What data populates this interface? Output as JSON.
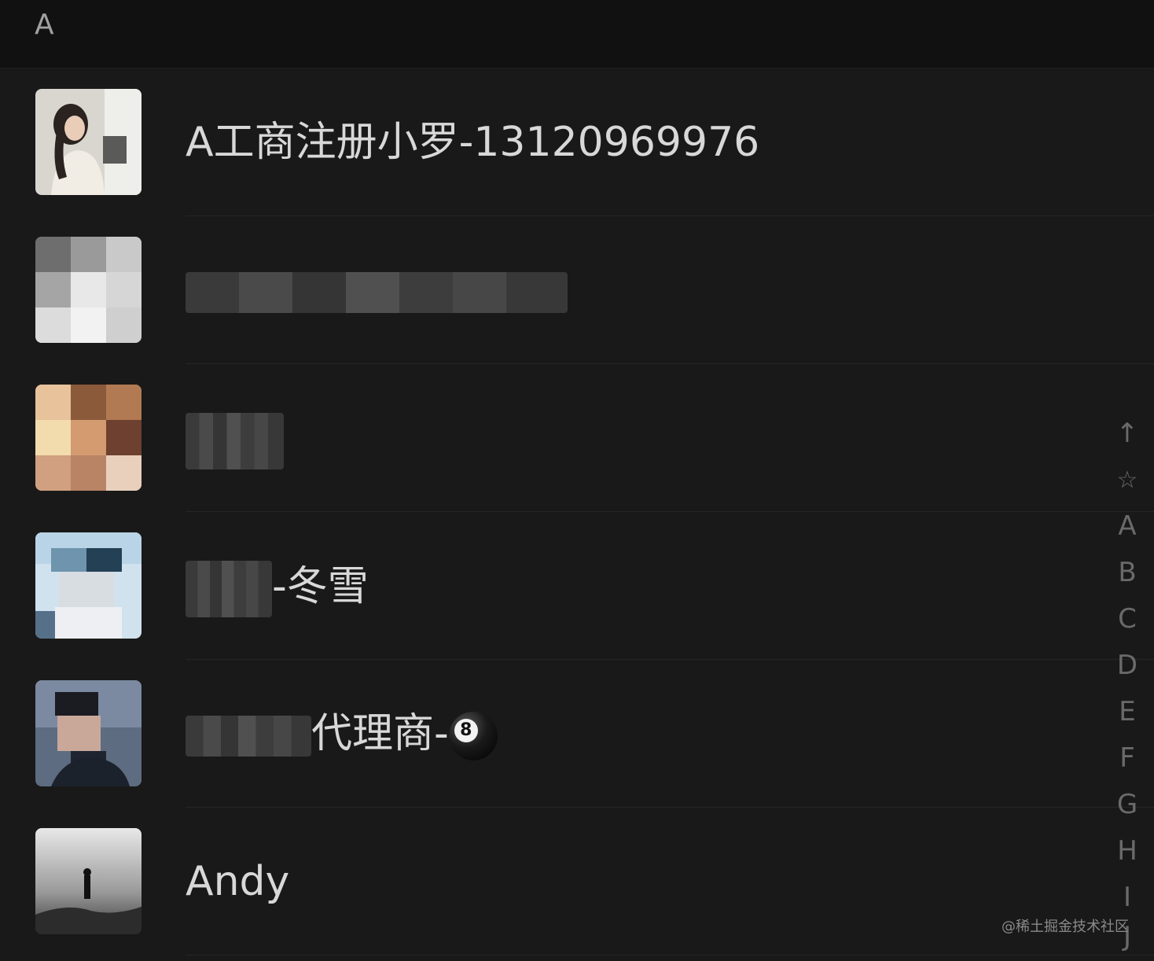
{
  "section": {
    "letter": "A"
  },
  "contacts": [
    {
      "name": "A工商注册小罗-13120969976",
      "avatar": "photo-woman-icon",
      "blurred": false
    },
    {
      "name": "",
      "avatar": "blurred-photo",
      "blurred": true
    },
    {
      "name": "",
      "avatar": "blurred-photo",
      "blurred": true
    },
    {
      "name_prefix_blurred": true,
      "name_suffix": "-冬雪",
      "avatar": "blurred-photo"
    },
    {
      "name_prefix_blurred": true,
      "name_suffix": "代理商-",
      "emoji": "8",
      "avatar": "blurred-photo"
    },
    {
      "name": "Andy",
      "avatar": "foggy-landscape-photo",
      "blurred": false
    }
  ],
  "index_bar": [
    "↑",
    "☆",
    "A",
    "B",
    "C",
    "D",
    "E",
    "F",
    "G",
    "H",
    "I",
    "J"
  ],
  "watermark": "@稀土掘金技术社区",
  "colors": {
    "background": "#191919",
    "header": "#111111",
    "text": "#d8d8d8",
    "index": "#6a6a6a"
  }
}
